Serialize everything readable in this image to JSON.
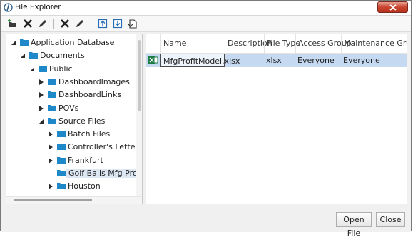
{
  "window": {
    "title": "File Explorer"
  },
  "toolbar": {
    "icons": [
      "add-folder-icon",
      "delete-folder-icon",
      "rename-folder-icon",
      "delete-file-icon",
      "edit-file-icon",
      "upload-icon",
      "download-icon",
      "extract-icon"
    ]
  },
  "tree": {
    "nodes": [
      {
        "label": "Application Database",
        "level": 0,
        "expanded": true
      },
      {
        "label": "Documents",
        "level": 1,
        "expanded": true
      },
      {
        "label": "Public",
        "level": 2,
        "expanded": true
      },
      {
        "label": "DashboardImages",
        "level": 3,
        "expanded": false
      },
      {
        "label": "DashboardLinks",
        "level": 3,
        "expanded": false
      },
      {
        "label": "POVs",
        "level": 3,
        "expanded": false
      },
      {
        "label": "Source Files",
        "level": 3,
        "expanded": true
      },
      {
        "label": "Batch Files",
        "level": 4,
        "expanded": false
      },
      {
        "label": "Controller's Letters",
        "level": 4,
        "expanded": false
      },
      {
        "label": "Frankfurt",
        "level": 4,
        "expanded": false
      },
      {
        "label": "Golf Balls Mfg Profit",
        "level": 4,
        "selected": true
      },
      {
        "label": "Houston",
        "level": 4,
        "expanded": false
      }
    ]
  },
  "grid": {
    "columns": [
      "Name",
      "Description",
      "File Type",
      "Access Group",
      "Maintenance Group"
    ],
    "rows": [
      {
        "name": "MfgProfitModel.xlsx",
        "description": "",
        "file_type": "xlsx",
        "access_group": "Everyone",
        "maintenance_group": "Everyone"
      }
    ]
  },
  "buttons": {
    "open_file": "Open File",
    "close": "Close"
  },
  "colors": {
    "folder": "#1e88c8",
    "selection": "#c5d9f1",
    "excel": "#1d7a43",
    "close": "#c9452f"
  }
}
